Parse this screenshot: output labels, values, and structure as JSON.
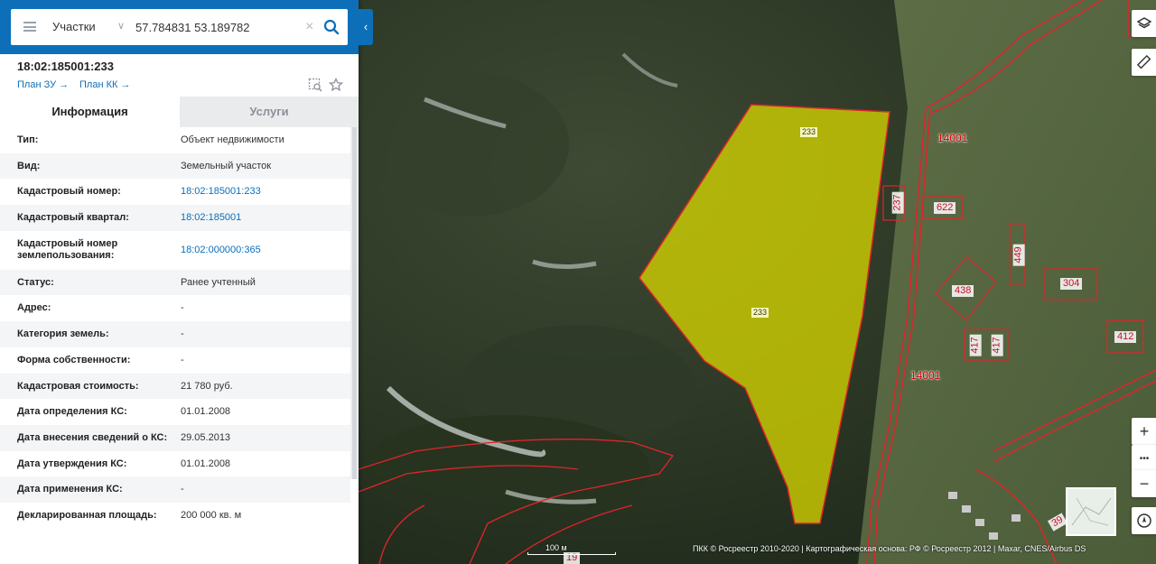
{
  "search": {
    "layer": "Участки",
    "query": "57.784831 53.189782"
  },
  "object": {
    "title": "18:02:185001:233",
    "plan_zu": "План ЗУ",
    "plan_kk": "План КК"
  },
  "tabs": {
    "info": "Информация",
    "services": "Услуги"
  },
  "rows": [
    {
      "label": "Тип:",
      "value": "Объект недвижимости",
      "link": false
    },
    {
      "label": "Вид:",
      "value": "Земельный участок",
      "link": false
    },
    {
      "label": "Кадастровый номер:",
      "value": "18:02:185001:233",
      "link": true
    },
    {
      "label": "Кадастровый квартал:",
      "value": "18:02:185001",
      "link": true
    },
    {
      "label": "Кадастровый номер землепользования:",
      "value": "18:02:000000:365",
      "link": true
    },
    {
      "label": "Статус:",
      "value": "Ранее учтенный",
      "link": false
    },
    {
      "label": "Адрес:",
      "value": "-",
      "link": false
    },
    {
      "label": "Категория земель:",
      "value": "-",
      "link": false
    },
    {
      "label": "Форма собственности:",
      "value": "-",
      "link": false
    },
    {
      "label": "Кадастровая стоимость:",
      "value": "21 780 руб.",
      "link": false
    },
    {
      "label": "Дата определения КС:",
      "value": "01.01.2008",
      "link": false
    },
    {
      "label": "Дата внесения сведений о КС:",
      "value": "29.05.2013",
      "link": false
    },
    {
      "label": "Дата утверждения КС:",
      "value": "01.01.2008",
      "link": false
    },
    {
      "label": "Дата применения КС:",
      "value": "-",
      "link": false
    },
    {
      "label": "Декларированная площадь:",
      "value": "200 000 кв. м",
      "link": false
    }
  ],
  "map": {
    "selected_parcel_label_top": "233",
    "selected_parcel_label_mid": "233",
    "quarter_label_top": "14001",
    "quarter_label_bottom": "14001",
    "parcels": {
      "p237": "237",
      "p622": "622",
      "p449": "449",
      "p438": "438",
      "p304": "304",
      "p412": "412",
      "p417a": "417",
      "p417b": "417",
      "p39": "39",
      "p19": "19"
    },
    "scale_label": "100 м",
    "attribution": "ПКК © Росреестр 2010-2020 | Картографическая основа: РФ © Росреестр 2012 | Maxar, CNES/Airbus DS",
    "selected_fill": "#d4d400",
    "boundary_color": "#e0242c"
  },
  "controls": {
    "zoom_in": "+",
    "more": "•••",
    "zoom_out": "−"
  }
}
